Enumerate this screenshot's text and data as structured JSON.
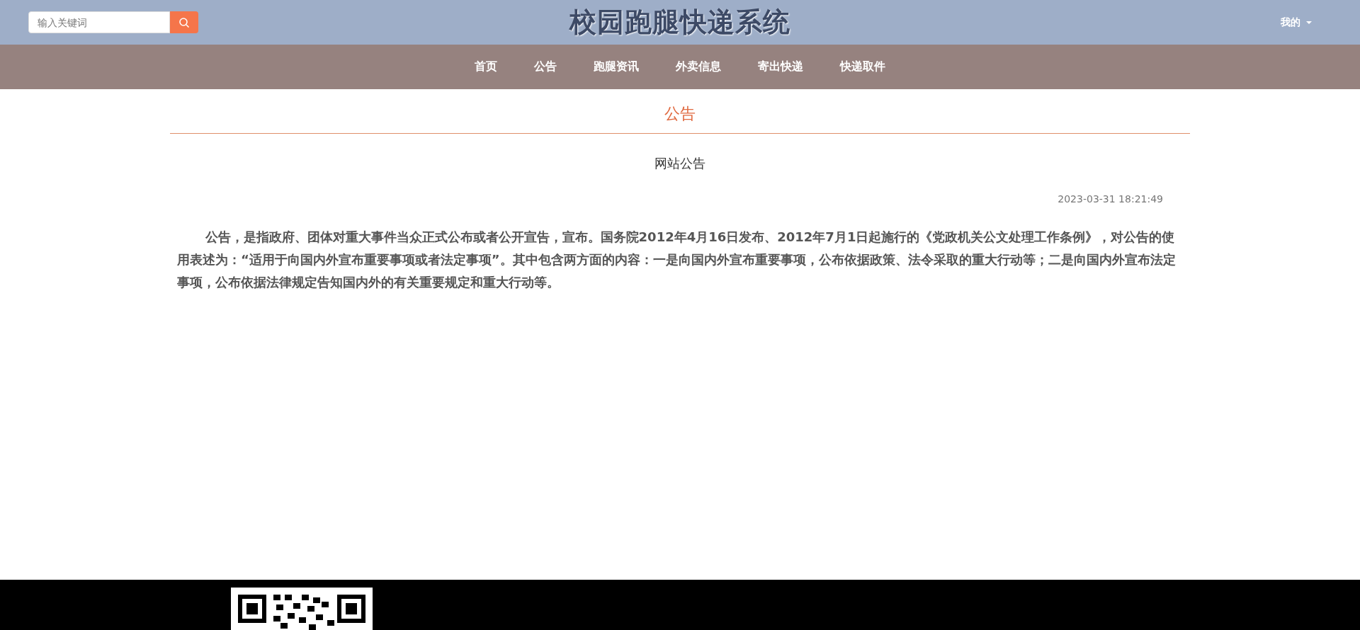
{
  "header": {
    "search": {
      "placeholder": "输入关键词"
    },
    "title": "校园跑腿快递系统",
    "user_menu": "我的"
  },
  "nav": [
    {
      "label": "首页"
    },
    {
      "label": "公告"
    },
    {
      "label": "跑腿资讯"
    },
    {
      "label": "外卖信息"
    },
    {
      "label": "寄出快递"
    },
    {
      "label": "快递取件"
    }
  ],
  "section_title": "公告",
  "article": {
    "title": "网站公告",
    "time": "2023-03-31 18:21:49",
    "body": "公告，是指政府、团体对重大事件当众正式公布或者公开宣告，宣布。国务院2012年4月16日发布、2012年7月1日起施行的《党政机关公文处理工作条例》，对公告的使用表述为：“适用于向国内外宣布重要事项或者法定事项”。其中包含两方面的内容：一是向国内外宣布重要事项，公布依据政策、法令采取的重大行动等；二是向国内外宣布法定事项，公布依据法律规定告知国内外的有关重要规定和重大行动等。"
  }
}
